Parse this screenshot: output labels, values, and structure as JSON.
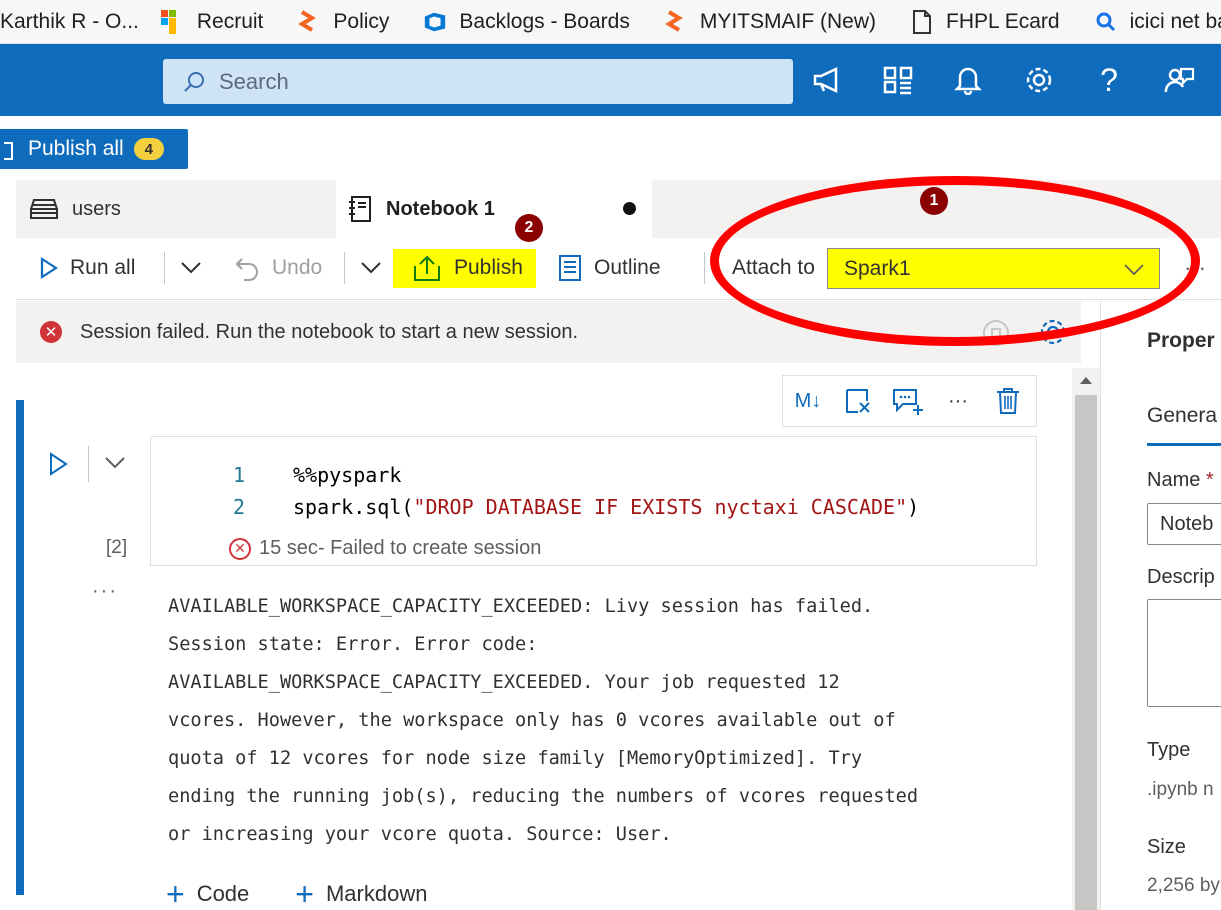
{
  "bookmarks": [
    {
      "label": "Karthik R - O...",
      "icon": "outlook-icon"
    },
    {
      "label": "Recruit",
      "icon": "recruit-icon"
    },
    {
      "label": "Policy",
      "icon": "policy-icon"
    },
    {
      "label": "Backlogs - Boards",
      "icon": "azure-devops-icon"
    },
    {
      "label": "MYITSMAIF (New)",
      "icon": "servicenow-icon"
    },
    {
      "label": "FHPL Ecard",
      "icon": "document-icon"
    },
    {
      "label": "icici net bar",
      "icon": "search-icon"
    }
  ],
  "topbar": {
    "search_placeholder": "Search"
  },
  "publish_all": {
    "label": "Publish all",
    "count": "4"
  },
  "tabs": [
    {
      "label": "users",
      "icon": "table-icon"
    },
    {
      "label": "Notebook 1",
      "icon": "notebook-icon"
    }
  ],
  "toolbar": {
    "run_all": "Run all",
    "undo": "Undo",
    "publish": "Publish",
    "outline": "Outline",
    "attach_to": "Attach to",
    "spark_pool": "Spark1",
    "more": "···"
  },
  "banner": {
    "message": "Session failed. Run the notebook to start a new session."
  },
  "cell": {
    "toolbar": [
      "M↓",
      "···"
    ],
    "execution_count": "[2]",
    "code": [
      {
        "num": "1",
        "text": "%%pyspark"
      },
      {
        "num": "2",
        "prefix": "spark.sql(",
        "string": "\"DROP DATABASE IF EXISTS nyctaxi CASCADE\"",
        "suffix": ")"
      }
    ],
    "status_time": "15 sec",
    "status_msg": " - Failed to create session",
    "output_dots": "···",
    "output": "AVAILABLE_WORKSPACE_CAPACITY_EXCEEDED: Livy session has failed.\nSession state: Error. Error code:\nAVAILABLE_WORKSPACE_CAPACITY_EXCEEDED. Your job requested 12\nvcores. However, the workspace only has 0 vcores available out of\nquota of 12 vcores for node size family [MemoryOptimized]. Try\nending the running job(s), reducing the numbers of vcores requested\nor increasing your vcore quota. Source: User."
  },
  "add_cell": {
    "code": "Code",
    "markdown": "Markdown"
  },
  "properties": {
    "title": "Proper",
    "tab": "Genera",
    "name_label": "Name",
    "name_required": "*",
    "name_value": "Noteb",
    "description_label": "Descrip",
    "type_label": "Type",
    "type_value": ".ipynb n",
    "size_label": "Size",
    "size_value": "2,256 by"
  },
  "annotations": {
    "marker1": "1",
    "marker2": "2"
  },
  "colors": {
    "accent": "#0f6cbd",
    "highlight": "#ffff00",
    "annotation": "#ff0000",
    "error": "#d13438"
  }
}
